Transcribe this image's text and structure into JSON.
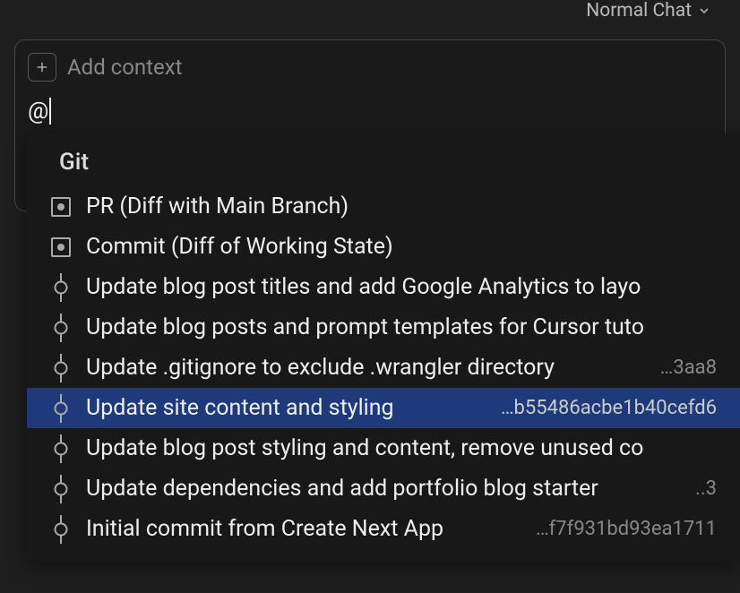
{
  "mode": {
    "label": "Normal Chat"
  },
  "input": {
    "add_context_placeholder": "Add context",
    "typed": "@"
  },
  "dropdown": {
    "section_label": "Git",
    "items": [
      {
        "type": "diff",
        "label": "PR (Diff with Main Branch)",
        "hash": ""
      },
      {
        "type": "diff",
        "label": "Commit (Diff of Working State)",
        "hash": ""
      },
      {
        "type": "commit",
        "label": "Update blog post titles and add Google Analytics to layo",
        "hash": ""
      },
      {
        "type": "commit",
        "label": "Update blog posts and prompt templates for Cursor tuto",
        "hash": ""
      },
      {
        "type": "commit",
        "label": "Update .gitignore to exclude .wrangler directory",
        "hash": "…3aa8"
      },
      {
        "type": "commit",
        "label": "Update site content and styling",
        "hash": "…b55486acbe1b40cefd6",
        "selected": true
      },
      {
        "type": "commit",
        "label": "Update blog post styling and content, remove unused co",
        "hash": ""
      },
      {
        "type": "commit",
        "label": "Update dependencies and add portfolio blog starter",
        "hash": "..3"
      },
      {
        "type": "commit",
        "label": "Initial commit from Create Next App",
        "hash": "…f7f931bd93ea1711"
      }
    ]
  }
}
